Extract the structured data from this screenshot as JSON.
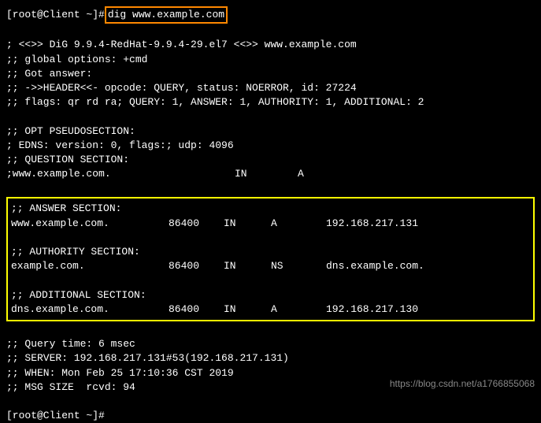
{
  "prompt": {
    "user_host": "[root@Client ~]# ",
    "command": "dig www.example.com"
  },
  "header": {
    "version_line": "; <<>> DiG 9.9.4-RedHat-9.9.4-29.el7 <<>> www.example.com",
    "global_options": ";; global options: +cmd",
    "got_answer": ";; Got answer:",
    "header_line": ";; ->>HEADER<<- opcode: QUERY, status: NOERROR, id: 27224",
    "flags_line": ";; flags: qr rd ra; QUERY: 1, ANSWER: 1, AUTHORITY: 1, ADDITIONAL: 2"
  },
  "opt": {
    "title": ";; OPT PSEUDOSECTION:",
    "edns": "; EDNS: version: 0, flags:; udp: 4096",
    "question_title": ";; QUESTION SECTION:",
    "question_name": ";www.example.com.",
    "question_class": "IN",
    "question_type": "A"
  },
  "answer": {
    "title": ";; ANSWER SECTION:",
    "name": "www.example.com.",
    "ttl": "86400",
    "class": "IN",
    "type": "A",
    "data": "192.168.217.131"
  },
  "authority": {
    "title": ";; AUTHORITY SECTION:",
    "name": "example.com.",
    "ttl": "86400",
    "class": "IN",
    "type": "NS",
    "data": "dns.example.com."
  },
  "additional": {
    "title": ";; ADDITIONAL SECTION:",
    "name": "dns.example.com.",
    "ttl": "86400",
    "class": "IN",
    "type": "A",
    "data": "192.168.217.130"
  },
  "footer": {
    "query_time": ";; Query time: 6 msec",
    "server": ";; SERVER: 192.168.217.131#53(192.168.217.131)",
    "when": ";; WHEN: Mon Feb 25 17:10:36 CST 2019",
    "msg_size": ";; MSG SIZE  rcvd: 94"
  },
  "prompt2": "[root@Client ~]#",
  "watermark": "https://blog.csdn.net/a1766855068"
}
